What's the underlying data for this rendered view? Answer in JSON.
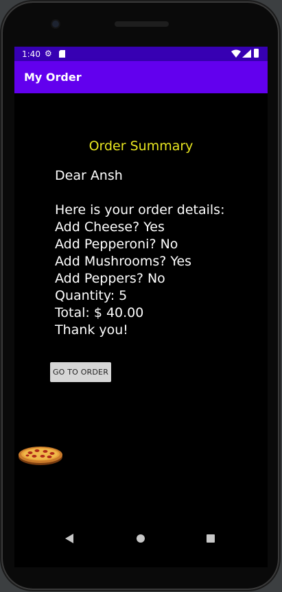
{
  "status_bar": {
    "time": "1:40",
    "icons": [
      "gear-icon",
      "sd-card-icon",
      "wifi-icon",
      "signal-icon",
      "battery-icon"
    ]
  },
  "app_bar": {
    "title": "My Order",
    "color": "#6200ee",
    "status_color": "#3700b3"
  },
  "summary": {
    "title": "Order Summary",
    "title_color": "#e8e620",
    "greeting": "Dear Ansh",
    "intro": "Here is your order details:",
    "lines": [
      "Add Cheese? Yes",
      "Add Pepperoni? No",
      "Add Mushrooms? Yes",
      "Add Peppers? No",
      "Quantity: 5",
      "Total: $ 40.00",
      "Thank you!"
    ]
  },
  "button": {
    "label": "GO TO ORDER"
  },
  "image": {
    "icon": "pizza-icon"
  },
  "nav_bar": {
    "icons": [
      "back-icon",
      "home-icon",
      "recents-icon"
    ]
  }
}
